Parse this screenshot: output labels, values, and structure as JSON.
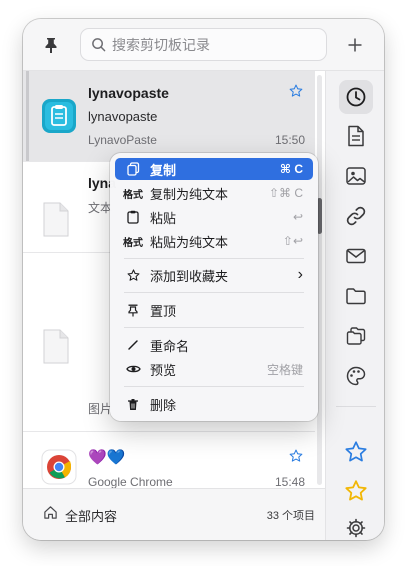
{
  "search": {
    "placeholder": "搜索剪切板记录"
  },
  "items": [
    {
      "title": "lynavopaste",
      "subtitle": "lynavopaste",
      "app": "LynavoPaste",
      "time": "15:50",
      "starred": false
    },
    {
      "title": "lyna",
      "subtitle": "文本",
      "app": "",
      "time": "",
      "starred": false
    },
    {
      "title": "",
      "subtitle": "",
      "app": "图片",
      "time": "",
      "starred": false
    },
    {
      "title": "💜💙",
      "subtitle": "",
      "app": "Google Chrome",
      "time": "15:48",
      "starred": false
    }
  ],
  "bottom": {
    "label": "全部内容",
    "count": "33 个项目"
  },
  "menu": {
    "items": [
      {
        "icon": "copy-icon",
        "label": "复制",
        "shortcut": "⌘ C"
      },
      {
        "icon": "格式",
        "label": "复制为纯文本",
        "shortcut": "⇧⌘ C"
      },
      {
        "icon": "clipboard-icon",
        "label": "粘贴",
        "shortcut": "↩"
      },
      {
        "icon": "格式",
        "label": "粘贴为纯文本",
        "shortcut": "⇧↩"
      },
      {
        "icon": "star-icon",
        "label": "添加到收藏夹",
        "shortcut": "›"
      },
      {
        "icon": "pin-icon",
        "label": "置顶",
        "shortcut": ""
      },
      {
        "icon": "pencil-icon",
        "label": "重命名",
        "shortcut": ""
      },
      {
        "icon": "eye-icon",
        "label": "预览",
        "shortcut": "空格键"
      },
      {
        "icon": "trash-icon",
        "label": "删除",
        "shortcut": ""
      }
    ]
  },
  "colors": {
    "accent": "#2f6fe0",
    "star": "#2a7de1",
    "gold": "#f2b705"
  }
}
